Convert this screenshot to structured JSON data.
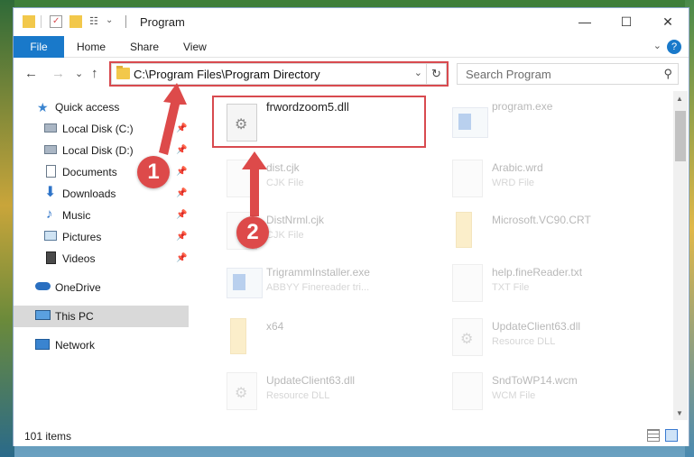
{
  "window": {
    "title": "Program",
    "controls": {
      "minimize": "—",
      "maximize": "☐",
      "close": "✕"
    }
  },
  "ribbon": {
    "file_tab": "File",
    "tabs": [
      "Home",
      "Share",
      "View"
    ],
    "help": "?"
  },
  "navigation": {
    "back": "←",
    "forward": "→",
    "recent": "⌄",
    "up": "↑",
    "address": "C:\\Program Files\\Program Directory",
    "refresh": "↻",
    "search_placeholder": "Search Program"
  },
  "sidebar": {
    "items": [
      {
        "label": "Quick access",
        "icon": "star-icon",
        "pinned": false
      },
      {
        "label": "Local Disk (C:)",
        "icon": "drive-icon",
        "pinned": true
      },
      {
        "label": "Local Disk (D:)",
        "icon": "drive-icon",
        "pinned": true
      },
      {
        "label": "Documents",
        "icon": "documents-icon",
        "pinned": true
      },
      {
        "label": "Downloads",
        "icon": "download-icon",
        "pinned": true
      },
      {
        "label": "Music",
        "icon": "music-icon",
        "pinned": true
      },
      {
        "label": "Pictures",
        "icon": "pictures-icon",
        "pinned": true
      },
      {
        "label": "Videos",
        "icon": "videos-icon",
        "pinned": true
      },
      {
        "label": "OneDrive",
        "icon": "cloud-icon",
        "pinned": false
      },
      {
        "label": "This PC",
        "icon": "pc-icon",
        "pinned": false,
        "selected": true
      },
      {
        "label": "Network",
        "icon": "network-icon",
        "pinned": false
      }
    ]
  },
  "files": [
    {
      "name": "frwordzoom5.dll",
      "type": "",
      "icon": "dll-gear-icon",
      "highlighted": true
    },
    {
      "name": "program.exe",
      "type": "",
      "icon": "exe-icon"
    },
    {
      "name": "dist.cjk",
      "type": "CJK File",
      "icon": "file-icon"
    },
    {
      "name": "Arabic.wrd",
      "type": "WRD File",
      "icon": "file-icon"
    },
    {
      "name": "DistNrml.cjk",
      "type": "CJK File",
      "icon": "file-icon"
    },
    {
      "name": "Microsoft.VC90.CRT",
      "type": "",
      "icon": "folder-icon"
    },
    {
      "name": "TrigrammInstaller.exe",
      "type": "ABBYY Finereader tri...",
      "icon": "exe-icon"
    },
    {
      "name": "help.fineReader.txt",
      "type": "TXT File",
      "icon": "file-icon"
    },
    {
      "name": "x64",
      "type": "",
      "icon": "folder-icon"
    },
    {
      "name": "UpdateClient63.dll",
      "type": "Resource DLL",
      "icon": "dll-gear-icon"
    },
    {
      "name": "UpdateClient63.dll",
      "type": "Resource DLL",
      "icon": "dll-gear-icon"
    },
    {
      "name": "SndToWP14.wcm",
      "type": "WCM File",
      "icon": "file-icon"
    }
  ],
  "status": {
    "item_count": "101 items"
  },
  "annotations": {
    "step1": "1",
    "step2": "2",
    "accent": "#dd4a4a"
  }
}
